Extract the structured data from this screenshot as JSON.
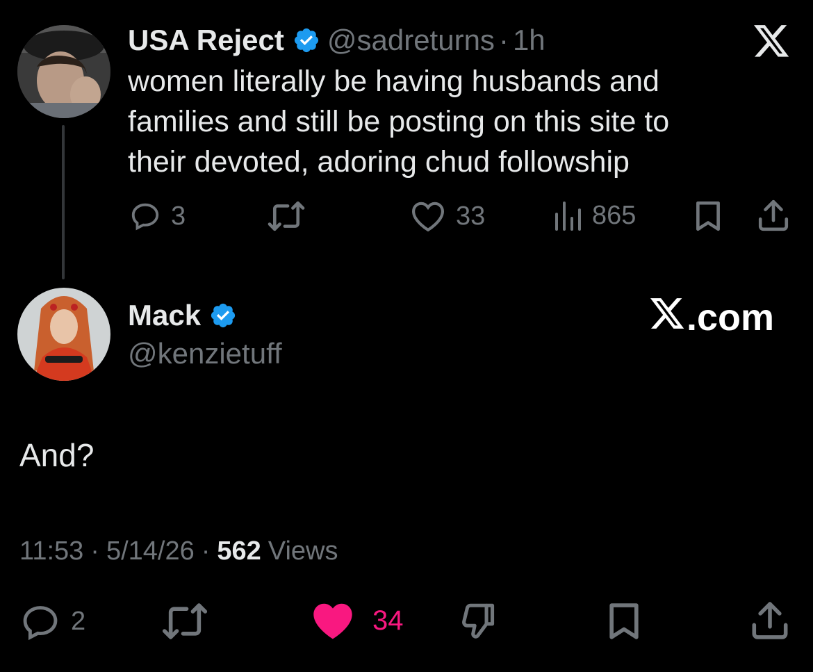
{
  "parent_tweet": {
    "display_name": "USA Reject",
    "handle": "@sadreturns",
    "separator": "·",
    "time_ago": "1h",
    "text_lines": [
      "women literally be having husbands and",
      "families and still be posting on this site to",
      "their devoted, adoring chud followship"
    ],
    "actions": {
      "replies": "3",
      "retweets": "",
      "likes": "33",
      "views": "865"
    },
    "platform_icon": "x-logo-icon"
  },
  "reply_tweet": {
    "display_name": "Mack",
    "handle": "@kenzietuff",
    "watermark": ".com",
    "text": "And?",
    "time": "11:53",
    "dot": "·",
    "date": "5/14/26",
    "views_count": "562",
    "views_label": "Views",
    "actions": {
      "replies": "2",
      "likes": "34"
    }
  },
  "colors": {
    "background": "#000000",
    "text": "#e7e9ea",
    "muted": "#71767b",
    "verified": "#1d9bf0",
    "liked": "#f91880"
  }
}
